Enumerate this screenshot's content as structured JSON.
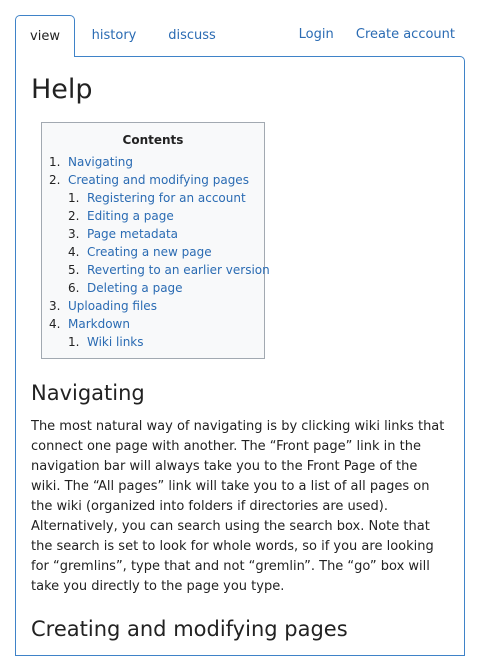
{
  "tabs": {
    "view": "view",
    "history": "history",
    "discuss": "discuss"
  },
  "userlinks": {
    "login": "Login",
    "create_account": "Create account"
  },
  "page": {
    "title": "Help"
  },
  "toc": {
    "title": "Contents",
    "items": [
      {
        "num": "1.",
        "label": "Navigating",
        "level": 1
      },
      {
        "num": "2.",
        "label": "Creating and modifying pages",
        "level": 1
      },
      {
        "num": "1.",
        "label": "Registering for an account",
        "level": 2
      },
      {
        "num": "2.",
        "label": "Editing a page",
        "level": 2
      },
      {
        "num": "3.",
        "label": "Page metadata",
        "level": 2
      },
      {
        "num": "4.",
        "label": "Creating a new page",
        "level": 2
      },
      {
        "num": "5.",
        "label": "Reverting to an earlier version",
        "level": 2
      },
      {
        "num": "6.",
        "label": "Deleting a page",
        "level": 2
      },
      {
        "num": "3.",
        "label": "Uploading files",
        "level": 1
      },
      {
        "num": "4.",
        "label": "Markdown",
        "level": 1
      },
      {
        "num": "1.",
        "label": "Wiki links",
        "level": 2
      }
    ]
  },
  "sections": {
    "navigating": {
      "heading": "Navigating",
      "text": "The most natural way of navigating is by clicking wiki links that connect one page with another. The “Front page” link in the navigation bar will always take you to the Front Page of the wiki. The “All pages” link will take you to a list of all pages on the wiki (organized into folders if directories are used). Alternatively, you can search using the search box. Note that the search is set to look for whole words, so if you are looking for “gremlins”, type that and not “gremlin”. The “go” box will take you directly to the page you type."
    },
    "creating": {
      "heading": "Creating and modifying pages"
    }
  },
  "colors": {
    "link": "#2a6bb3",
    "border": "#3f83c8",
    "toc_bg": "#f8f9fa"
  }
}
